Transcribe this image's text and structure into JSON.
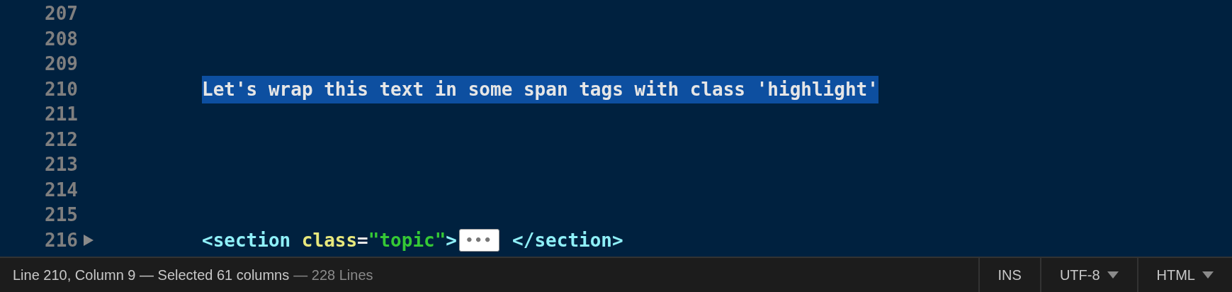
{
  "editor": {
    "lines": [
      {
        "number": "207",
        "folded": false,
        "selected": false
      },
      {
        "number": "208",
        "folded": false,
        "selected": false
      },
      {
        "number": "209",
        "folded": false,
        "selected": false
      },
      {
        "number": "210",
        "folded": false,
        "selected": true,
        "tokens": [
          {
            "kind": "text",
            "text": "Let's wrap this text in some span tags with class 'highlight'"
          }
        ]
      },
      {
        "number": "211",
        "folded": false,
        "selected": false
      },
      {
        "number": "212",
        "folded": false,
        "selected": false
      },
      {
        "number": "213",
        "folded": false,
        "selected": false
      },
      {
        "number": "214",
        "folded": false,
        "selected": false
      },
      {
        "number": "215",
        "folded": false,
        "selected": false
      },
      {
        "number": "216",
        "folded": true,
        "selected": false,
        "tokens": [
          {
            "kind": "tag",
            "text": "<section"
          },
          {
            "kind": "attr",
            "text": "class"
          },
          {
            "kind": "punct",
            "text": "="
          },
          {
            "kind": "string",
            "text": "\"topic\""
          },
          {
            "kind": "tag",
            "text": ">"
          },
          {
            "kind": "fold",
            "text": "•••"
          },
          {
            "kind": "tag",
            "text": "</section>"
          }
        ]
      }
    ]
  },
  "status_bar": {
    "info": "Line 210, Column 9 — Selected 61 columns",
    "line_count": "— 228 Lines",
    "cells": [
      {
        "kind": "plain",
        "label": "INS"
      },
      {
        "kind": "dropdown",
        "label": "UTF-8"
      },
      {
        "kind": "dropdown",
        "label": "HTML"
      }
    ]
  }
}
